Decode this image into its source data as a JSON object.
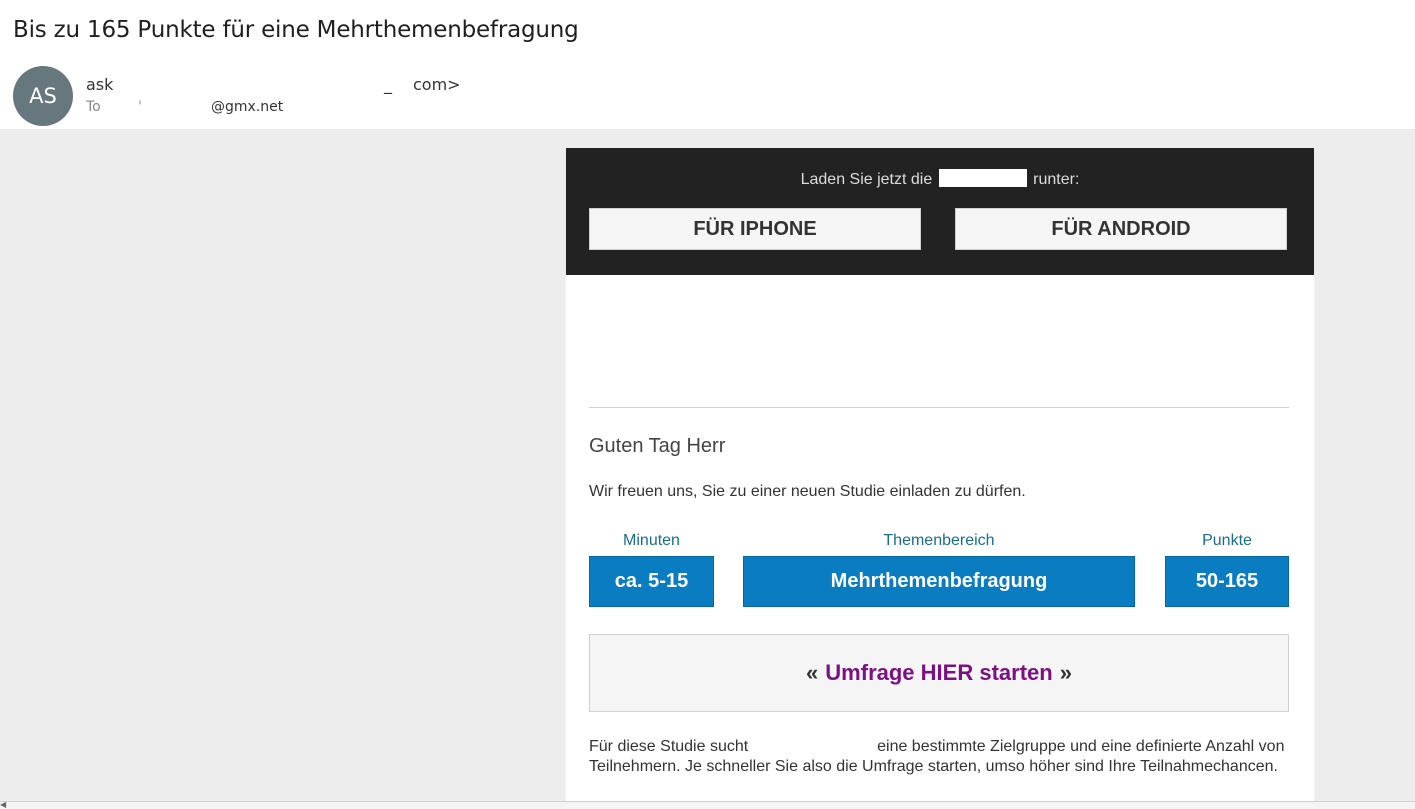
{
  "email": {
    "subject": "Bis zu 165 Punkte für eine Mehrthemenbefragung",
    "avatar_initials": "AS",
    "sender_start": "ask",
    "sender_redaction_mark": "_",
    "sender_end": "com>",
    "to_label": "To",
    "to_redaction_mark": "'",
    "to_domain": "@gmx.net"
  },
  "header": {
    "download_before": "Laden Sie jetzt die",
    "download_after": "runter:",
    "iphone_button": "FÜR IPHONE",
    "android_button": "FÜR ANDROID"
  },
  "content": {
    "greeting": "Guten Tag Herr",
    "intro": "Wir freuen uns, Sie zu einer neuen Studie einladen zu dürfen.",
    "info": [
      {
        "label": "Minuten",
        "value": "ca. 5-15"
      },
      {
        "label": "Themenbereich",
        "value": "Mehrthemenbefragung"
      },
      {
        "label": "Punkte",
        "value": "50-165"
      }
    ],
    "start_open": "«",
    "start_link": "Umfrage HIER starten",
    "start_close": "»",
    "study_text_before": "Für diese Studie sucht",
    "study_text_after": "eine bestimmte Zielgruppe und eine definierte Anzahl von Teilnehmern. Je schneller Sie also die Umfrage starten, umso höher sind Ihre Teilnahmechancen."
  },
  "colors": {
    "info_box": "#0a7cc1",
    "link": "#7b1282",
    "header_bg": "#222222",
    "avatar": "#66777e"
  },
  "icons": {
    "scroll_left": "triangle-left-icon"
  }
}
